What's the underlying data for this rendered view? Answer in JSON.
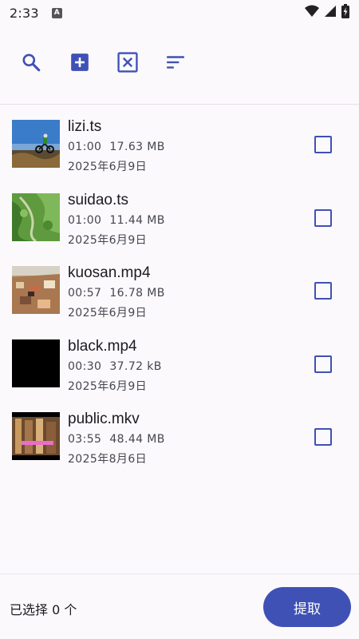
{
  "status_bar": {
    "time": "2:33",
    "notification_icon_letter": "A"
  },
  "toolbar": {
    "icons": [
      "search-icon",
      "add-box-icon",
      "close-box-icon",
      "sort-icon"
    ]
  },
  "colors": {
    "accent": "#3f51b5",
    "background": "#fcf9fd",
    "text_primary": "#1b1b1f",
    "text_secondary": "#44464f"
  },
  "files": [
    {
      "name": "lizi.ts",
      "duration": "01:00",
      "size": "17.63 MB",
      "date": "2025年6月9日",
      "checked": false
    },
    {
      "name": "suidao.ts",
      "duration": "01:00",
      "size": "11.44 MB",
      "date": "2025年6月9日",
      "checked": false
    },
    {
      "name": "kuosan.mp4",
      "duration": "00:57",
      "size": "16.78 MB",
      "date": "2025年6月9日",
      "checked": false
    },
    {
      "name": "black.mp4",
      "duration": "00:30",
      "size": "37.72 kB",
      "date": "2025年6月9日",
      "checked": false
    },
    {
      "name": "public.mkv",
      "duration": "03:55",
      "size": "48.44 MB",
      "date": "2025年8月6日",
      "checked": false
    }
  ],
  "footer": {
    "selected_count_text": "已选择 0 个",
    "extract_label": "提取"
  }
}
